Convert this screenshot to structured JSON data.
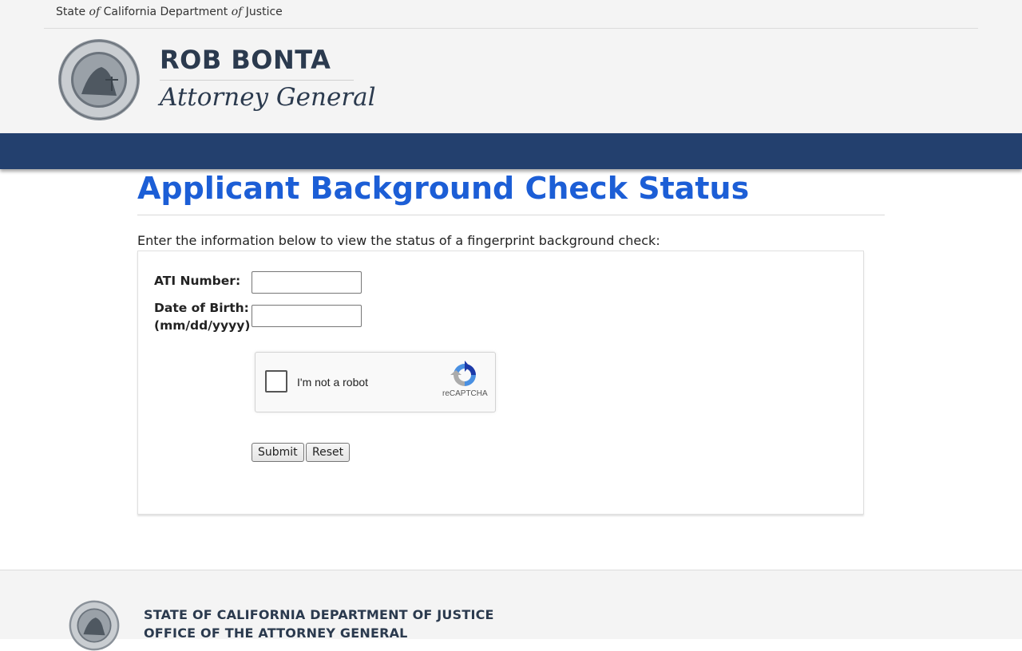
{
  "header": {
    "topline_1": "State",
    "topline_of_1": "of",
    "topline_2": "California Department",
    "topline_of_2": "of",
    "topline_3": "Justice",
    "seal_icon": "california-doj-seal-icon",
    "name": "ROB BONTA",
    "title": "Attorney General"
  },
  "main": {
    "page_title": "Applicant Background Check Status",
    "intro": "Enter the information below to view the status of a fingerprint background check:",
    "ati_label": "ATI Number:",
    "ati_value": "",
    "dob_label": "Date of Birth:",
    "dob_format": "(mm/dd/yyyy)",
    "dob_value": "",
    "captcha": {
      "label": "I'm not a robot",
      "brand": "reCAPTCHA",
      "checked": false
    },
    "submit_label": "Submit",
    "reset_label": "Reset"
  },
  "footer": {
    "line1": "STATE OF CALIFORNIA DEPARTMENT OF JUSTICE",
    "line2": "OFFICE OF THE ATTORNEY GENERAL"
  },
  "colors": {
    "navbar": "#23406e",
    "title_blue": "#1c5ed6",
    "header_text": "#2b3a4e"
  }
}
